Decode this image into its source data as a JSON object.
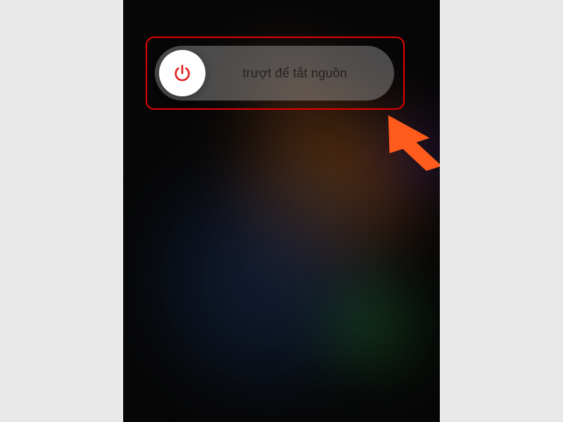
{
  "slider": {
    "label": "trượt để tắt nguồn",
    "icon_name": "power"
  },
  "colors": {
    "accent_red": "#e01f1f",
    "annotation_orange": "#ff5b1c",
    "highlight_border": "#e60000"
  }
}
